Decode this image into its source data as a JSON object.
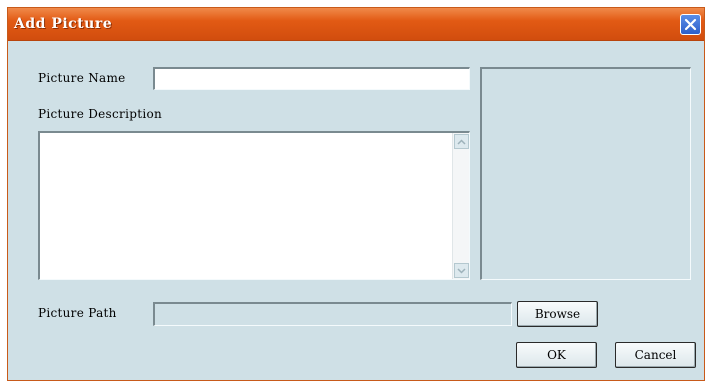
{
  "dialog": {
    "title": "Add Picture",
    "close_icon": "close-icon",
    "accent_color": "#e25a14",
    "background_color": "#cfe0e6"
  },
  "form": {
    "name_label": "Picture Name",
    "name_value": "",
    "description_label": "Picture Description",
    "description_value": "",
    "path_label": "Picture Path",
    "path_value": ""
  },
  "buttons": {
    "browse": "Browse",
    "ok": "OK",
    "cancel": "Cancel"
  },
  "icons": {
    "scroll_up": "chevron-up-icon",
    "scroll_down": "chevron-down-icon"
  }
}
